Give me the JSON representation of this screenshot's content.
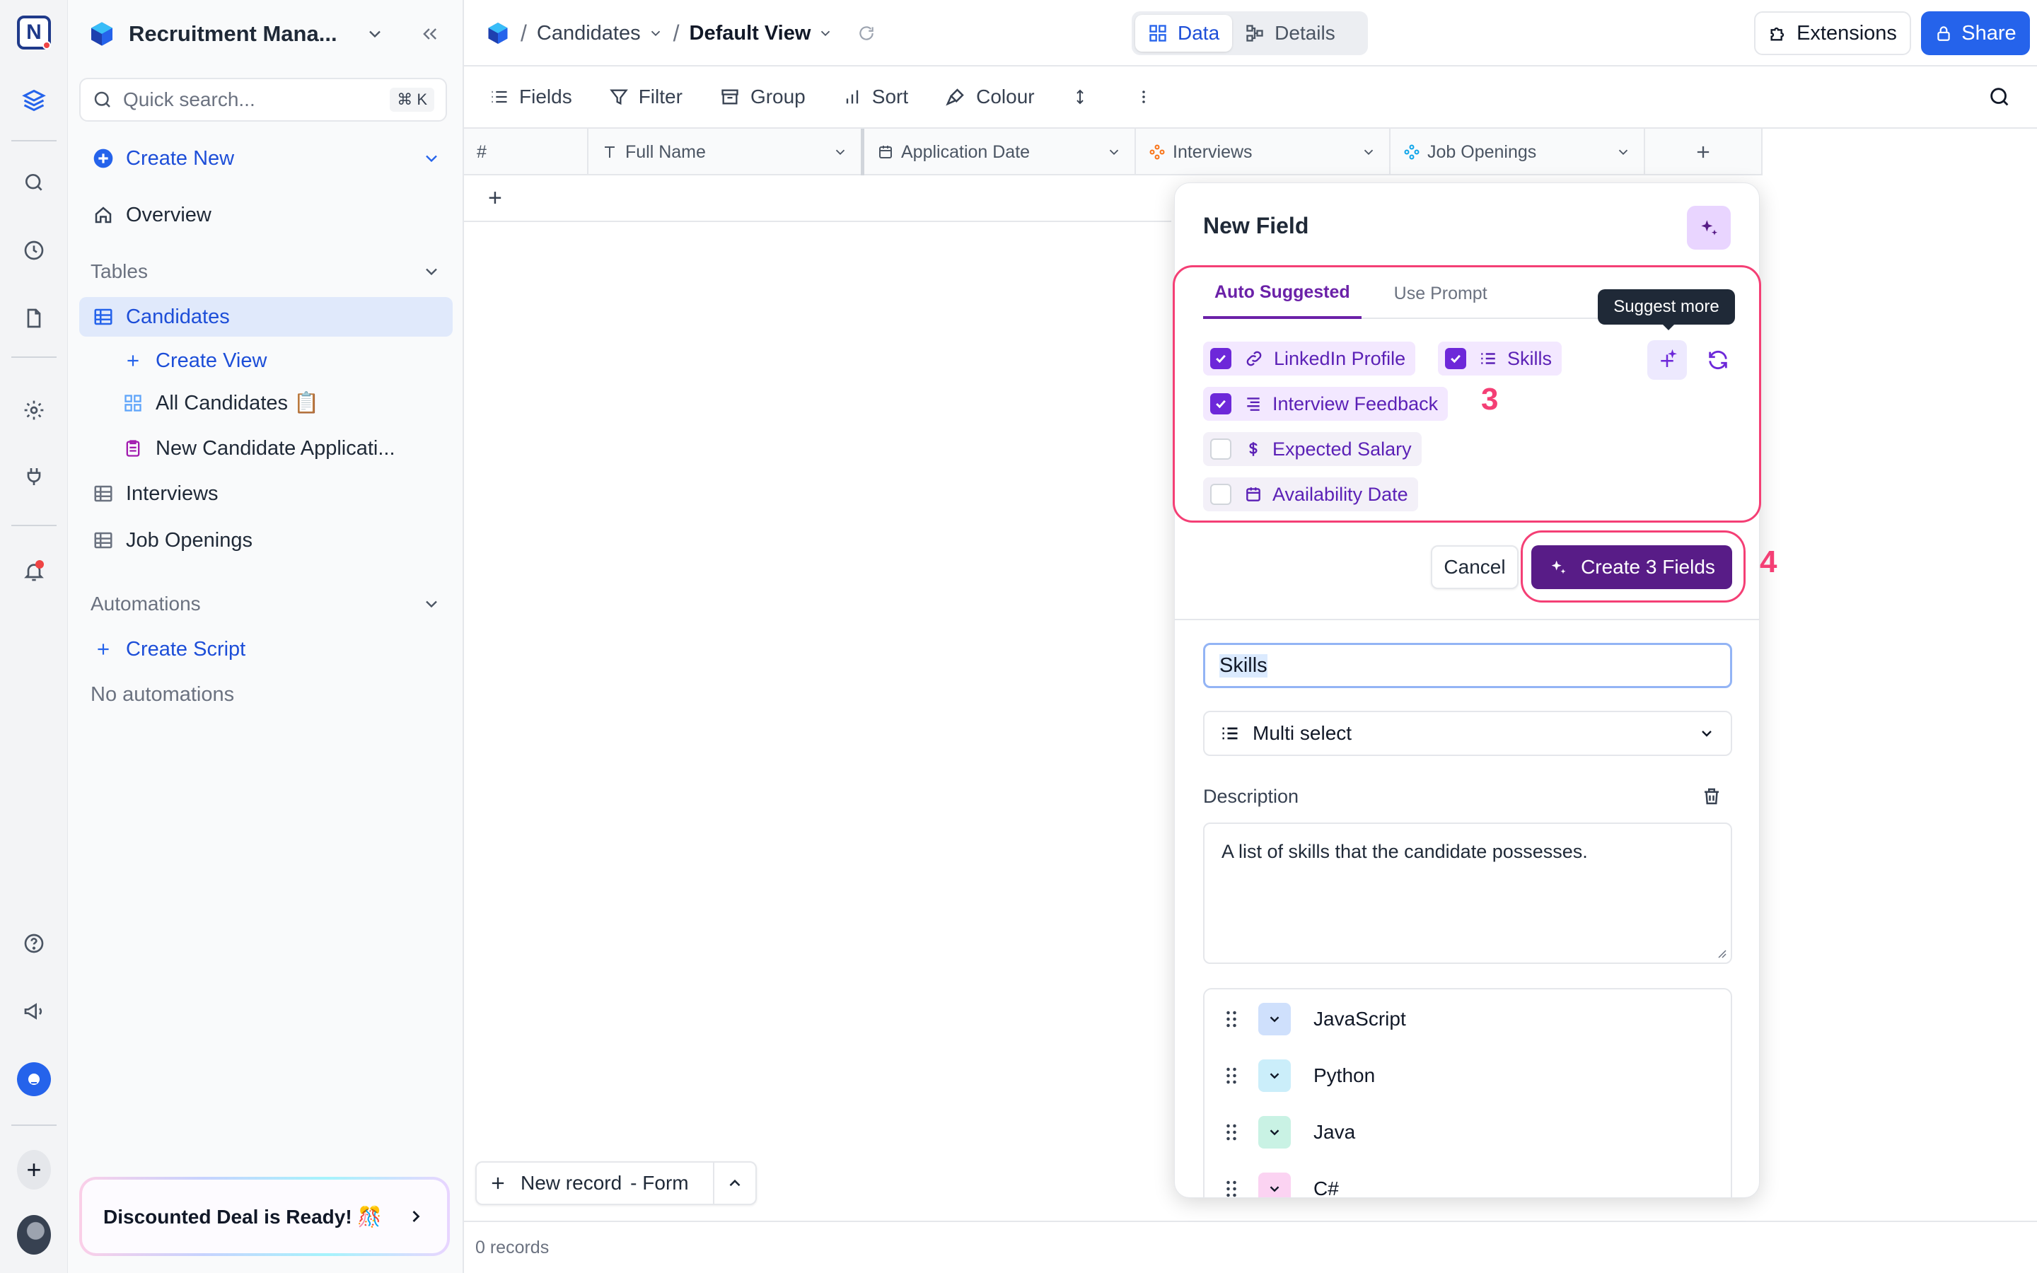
{
  "rail": {
    "icons": [
      "app-logo-icon",
      "database-icon",
      "search-icon",
      "history-icon",
      "document-icon",
      "settings-icon",
      "plug-icon",
      "bell-icon",
      "help-icon",
      "megaphone-icon",
      "chat-icon",
      "plus-icon",
      "avatar"
    ]
  },
  "sidebar": {
    "project_title": "Recruitment Mana...",
    "search_placeholder": "Quick search...",
    "search_shortcut": "⌘ K",
    "create_new": "Create New",
    "overview": "Overview",
    "tables_header": "Tables",
    "tables": [
      {
        "label": "Candidates",
        "active": true
      },
      {
        "label": "Interviews"
      },
      {
        "label": "Job Openings"
      }
    ],
    "create_view": "Create View",
    "views": [
      {
        "label": "All Candidates 📋"
      },
      {
        "label": "New Candidate Applicati..."
      }
    ],
    "automations_header": "Automations",
    "create_script": "Create Script",
    "no_automations": "No automations",
    "deal_banner": "Discounted Deal is Ready! 🎊"
  },
  "topbar": {
    "breadcrumb_table": "Candidates",
    "breadcrumb_view": "Default View",
    "tab_data": "Data",
    "tab_details": "Details",
    "extensions": "Extensions",
    "share": "Share"
  },
  "toolbar": {
    "fields": "Fields",
    "filter": "Filter",
    "group": "Group",
    "sort": "Sort",
    "colour": "Colour"
  },
  "grid": {
    "columns": [
      {
        "label": "#"
      },
      {
        "label": "Full Name"
      },
      {
        "label": "Application Date"
      },
      {
        "label": "Interviews"
      },
      {
        "label": "Job Openings"
      }
    ],
    "add_row": "+",
    "new_record": "New record",
    "new_record_mode": "- Form",
    "records_count": "0 records"
  },
  "modal": {
    "title": "New Field",
    "tab_auto": "Auto Suggested",
    "tab_prompt": "Use Prompt",
    "tooltip": "Suggest more",
    "suggestions": [
      {
        "label": "LinkedIn Profile",
        "checked": true,
        "icon": "link-icon"
      },
      {
        "label": "Skills",
        "checked": true,
        "icon": "list-icon"
      },
      {
        "label": "Interview Feedback",
        "checked": true,
        "icon": "longtext-icon"
      },
      {
        "label": "Expected Salary",
        "checked": false,
        "icon": "dollar-icon"
      },
      {
        "label": "Availability Date",
        "checked": false,
        "icon": "calendar-icon"
      }
    ],
    "cancel": "Cancel",
    "create": "Create 3 Fields",
    "field_name": "Skills",
    "field_type": "Multi select",
    "description_label": "Description",
    "description": "A list of skills that the candidate possesses.",
    "options": [
      {
        "label": "JavaScript",
        "color": "#cfe0fc"
      },
      {
        "label": "Python",
        "color": "#cbeefa"
      },
      {
        "label": "Java",
        "color": "#c9f2e4"
      },
      {
        "label": "C#",
        "color": "#fbd3f2"
      }
    ]
  },
  "annotations": {
    "step3": "3",
    "step4": "4"
  },
  "colors": {
    "accent_blue": "#2563eb",
    "accent_purple": "#581c87",
    "annotation_pink": "#f43f75"
  }
}
